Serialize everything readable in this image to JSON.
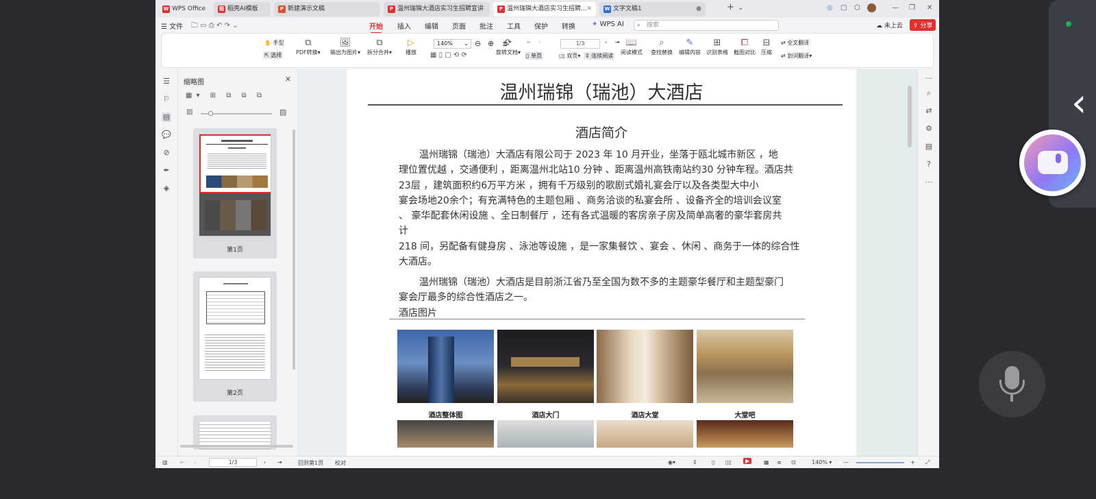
{
  "tabs": [
    {
      "label": "WPS Office",
      "icon": "wps-logo-icon",
      "color": "#e23030"
    },
    {
      "label": "稻壳AI模板",
      "icon": "docer-icon",
      "color": "#e23030"
    },
    {
      "label": "新建演示文稿",
      "icon": "presentation-icon",
      "color": "#e0502a"
    },
    {
      "label": "温州瑞锦大酒店实习生招聘宣讲",
      "icon": "pdf-icon",
      "color": "#e23030"
    },
    {
      "label": "温州瑞锦大酒店实习生招聘...",
      "icon": "pdf-icon",
      "color": "#e23030"
    },
    {
      "label": "文字文稿1",
      "icon": "word-icon",
      "color": "#2d6de5"
    }
  ],
  "menubar": {
    "file": "文件",
    "items": [
      "开始",
      "插入",
      "编辑",
      "页面",
      "批注",
      "工具",
      "保护",
      "转换",
      "WPS AI"
    ],
    "active": "开始",
    "search_placeholder": "搜索",
    "cloud": "未上云",
    "share": "分享"
  },
  "ribbon": {
    "hand": "手型",
    "select": "选择",
    "pdf_convert": "PDF转换",
    "export_image": "输出为图片",
    "split_merge": "拆分合并",
    "play": "播放",
    "zoom": "140%",
    "page": "1/3",
    "rotate": "旋转文档",
    "single": "单页",
    "double": "双页",
    "continuous": "连续阅读",
    "read_mode": "阅读模式",
    "find_replace": "查找替换",
    "edit_content": "编辑内容",
    "recognize_table": "识别表格",
    "screenshot_compare": "截图对比",
    "compress": "压缩",
    "translate_full": "全文翻译",
    "translate_select": "划词翻译"
  },
  "thumbnails": {
    "title": "缩略图",
    "pages": [
      "第1页",
      "第2页"
    ]
  },
  "document": {
    "title": "温州瑞锦（瑞池）大酒店",
    "subtitle": "酒店简介",
    "para1": [
      "温州瑞锦（瑞池）大酒店有限公司于 2023 年 10 月开业，坐落于瓯北城市新区 ，地",
      "理位置优越 ，交通便利 ，距离温州北站10 分钟 、距离温州高铁南站约30 分钟车程。酒店共",
      "23层 ，建筑面积约6万平方米 ，拥有千万级别的歌剧式婚礼宴会厅以及各类型大中小",
      "宴会场地20余个；有充满特色的主题包厢 、商务洽谈的私宴会所 、设备齐全的培训会议室",
      "、 豪华配套休闲设施 、全日制餐厅 ，还有各式温暖的客房亲子房及简单高奢的豪华套房共",
      "计",
      "218 间，另配备有健身房 、泳池等设施 ，是一家集餐饮 、宴会 、休闲 、商务于一体的综合性",
      "大酒店。"
    ],
    "para2": [
      "温州瑞锦（瑞池）大酒店是目前浙江省乃至全国为数不多的主题豪华餐厅和主题型豪门",
      "宴会厅最多的综合性酒店之一。"
    ],
    "section_label": "酒店图片",
    "photos": [
      "酒店整体图",
      "酒店大门",
      "酒店大堂",
      "大堂吧"
    ]
  },
  "statusbar": {
    "page": "1/3",
    "back": "回到第1页",
    "proof": "校对",
    "zoom": "140%"
  }
}
